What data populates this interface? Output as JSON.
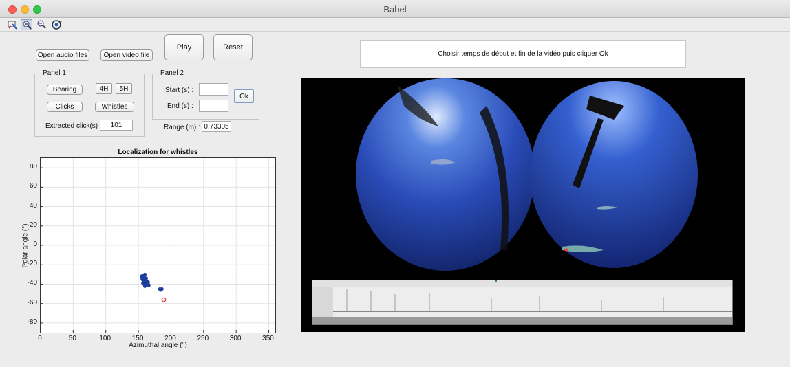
{
  "window": {
    "title": "Babel"
  },
  "toolbar": {
    "tools": [
      "data-cursor-icon",
      "zoom-in-icon",
      "zoom-out-icon",
      "rotate-icon"
    ]
  },
  "buttons": {
    "open_audio": "Open audio files",
    "open_video": "Open video file",
    "play": "Play",
    "reset": "Reset"
  },
  "panel1": {
    "title": "Panel 1",
    "bearing": "Bearing",
    "h4": "4H",
    "h5": "5H",
    "clicks": "Clicks",
    "whistles": "Whistles",
    "extracted_label": "Extracted click(s) :",
    "extracted_value": "101"
  },
  "panel2": {
    "title": "Panel 2",
    "start_label": "Start (s) :",
    "start_value": "",
    "end_label": "End (s) :",
    "end_value": "",
    "ok": "Ok"
  },
  "range": {
    "label": "Range (m) :",
    "value": "0.73305"
  },
  "status": {
    "message": "Choisir temps de début et fin de la vidéo puis cliquer Ok"
  },
  "chart_data": {
    "type": "scatter",
    "title": "Localization for whistles",
    "xlabel": "Azimuthal angle (°)",
    "ylabel": "Polar angle (°)",
    "xlim": [
      0,
      360
    ],
    "ylim": [
      -90,
      90
    ],
    "xticks": [
      0,
      50,
      100,
      150,
      200,
      250,
      300,
      350
    ],
    "yticks": [
      80,
      60,
      40,
      20,
      0,
      -20,
      -40,
      -60,
      -80
    ],
    "grid": true,
    "series": [
      {
        "color": "#1f3f9f",
        "marker": "filled-circle",
        "x": [
          155,
          156,
          157,
          158,
          158,
          159,
          160,
          160,
          161,
          162,
          157,
          159,
          161,
          163,
          165,
          166,
          164,
          162,
          160,
          158,
          156,
          183,
          184,
          186
        ],
        "y": [
          -32,
          -34,
          -31,
          -35,
          -37,
          -33,
          -30,
          -38,
          -36,
          -34,
          -39,
          -40,
          -39,
          -37,
          -38,
          -41,
          -40,
          -41,
          -42,
          -36,
          -35,
          -45,
          -46,
          -45
        ]
      },
      {
        "color": "#e03030",
        "marker": "open-circle",
        "x": [
          189
        ],
        "y": [
          -56
        ]
      }
    ]
  }
}
